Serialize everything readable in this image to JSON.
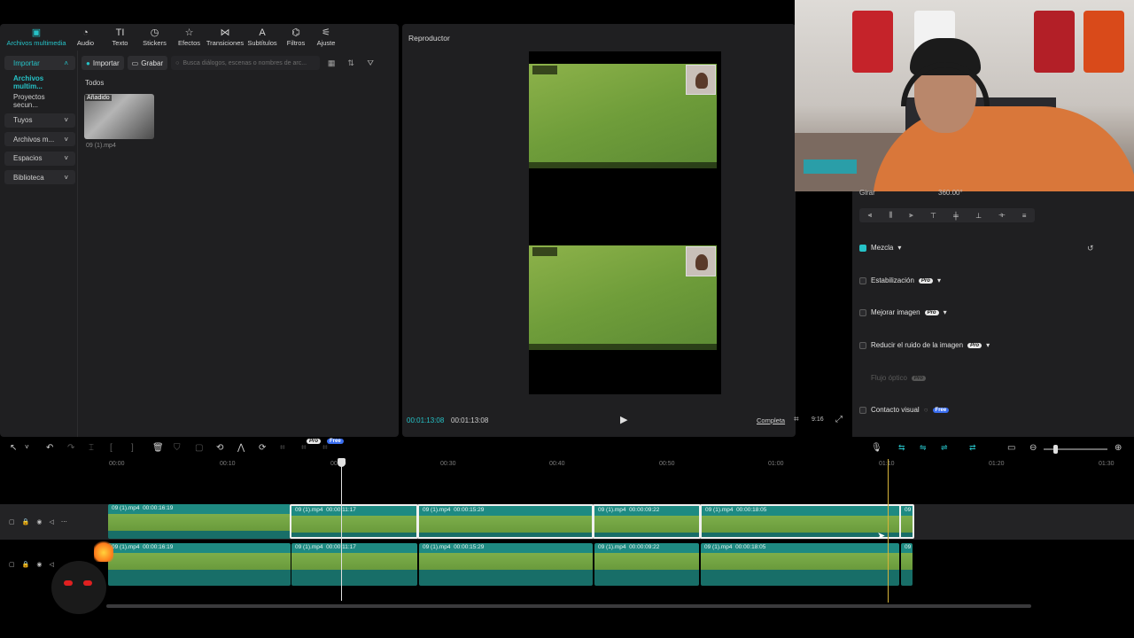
{
  "toolbar": {
    "items": [
      {
        "label": "Archivos multimedia",
        "icon": "media-icon"
      },
      {
        "label": "Audio",
        "icon": "audio-icon"
      },
      {
        "label": "Texto",
        "icon": "text-icon"
      },
      {
        "label": "Stickers",
        "icon": "sticker-icon"
      },
      {
        "label": "Efectos",
        "icon": "effects-icon"
      },
      {
        "label": "Transiciones",
        "icon": "transition-icon"
      },
      {
        "label": "Subtítulos",
        "icon": "subtitle-icon"
      },
      {
        "label": "Filtros",
        "icon": "filter-icon"
      },
      {
        "label": "Ajuste",
        "icon": "adjust-icon"
      }
    ]
  },
  "leftnav": {
    "items": [
      {
        "label": "Importar"
      },
      {
        "label": "Archivos multim..."
      },
      {
        "label": "Proyectos secun..."
      },
      {
        "label": "Tuyos"
      },
      {
        "label": "Archivos m..."
      },
      {
        "label": "Espacios"
      },
      {
        "label": "Biblioteca"
      }
    ]
  },
  "media": {
    "import_label": "Importar",
    "record_label": "Grabar",
    "search_placeholder": "Busca diálogos, escenas o nombres de arc...",
    "tab_all": "Todos",
    "asset": {
      "badge": "Añadido",
      "name": "09 (1).mp4"
    }
  },
  "player": {
    "title": "Reproductor",
    "current_time": "00:01:13:08",
    "total_time": "00:01:13:08",
    "complete_label": "Completa",
    "ratio_label": "9:16"
  },
  "properties": {
    "rotate_label": "Girar",
    "rotate_value": "360.00°",
    "blend_label": "Mezcla",
    "stabilization_label": "Estabilización",
    "enhance_label": "Mejorar imagen",
    "denoise_label": "Reducir el ruido de la imagen",
    "optical_flow_label": "Flujo óptico",
    "eye_contact_label": "Contacto visual",
    "pro_badge": "Pro",
    "free_badge": "Free"
  },
  "timeline": {
    "ruler": [
      "00:00",
      "00:10",
      "00:20",
      "00:30",
      "00:40",
      "00:50",
      "01:00",
      "01:10",
      "01:20",
      "01:30"
    ],
    "track1": [
      {
        "name": "09 (1).mp4",
        "duration": "00:00:16:19"
      },
      {
        "name": "09 (1).mp4",
        "duration": "00:00:11:17"
      },
      {
        "name": "09 (1).mp4",
        "duration": "00:00:15:29"
      },
      {
        "name": "09 (1).mp4",
        "duration": "00:00:09:22"
      },
      {
        "name": "09 (1).mp4",
        "duration": "00:00:18:05"
      },
      {
        "name": "09",
        "duration": ""
      }
    ],
    "track2": [
      {
        "name": "09 (1).mp4",
        "duration": "00:00:16:19"
      },
      {
        "name": "09 (1).mp4",
        "duration": "00:00:11:17"
      },
      {
        "name": "09 (1).mp4",
        "duration": "00:00:15:29"
      },
      {
        "name": "09 (1).mp4",
        "duration": "00:00:09:22"
      },
      {
        "name": "09 (1).mp4",
        "duration": "00:00:18:05"
      },
      {
        "name": "09",
        "duration": ""
      }
    ],
    "badges": {
      "pro": "Pro",
      "free": "Free"
    }
  },
  "colors": {
    "accent": "#26c2c7",
    "panel": "#1f1f21",
    "clip": "#1e8a82"
  }
}
